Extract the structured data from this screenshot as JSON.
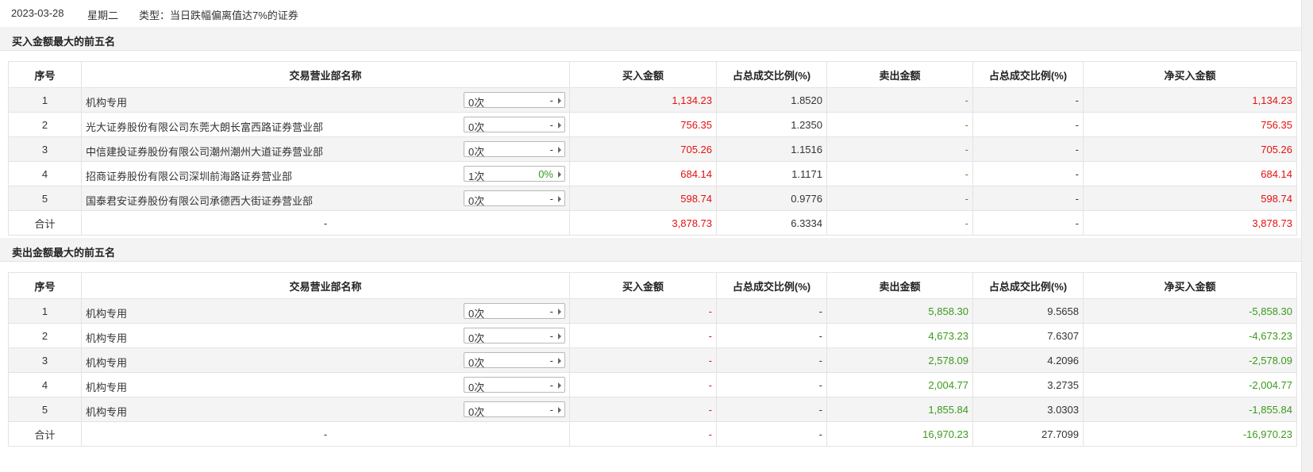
{
  "header": {
    "date": "2023-03-28",
    "weekday": "星期二",
    "type": "类型：当日跌幅偏离值达7%的证券"
  },
  "columns": [
    "序号",
    "交易营业部名称",
    "买入金额",
    "占总成交比例(%)",
    "卖出金额",
    "占总成交比例(%)",
    "净买入金额"
  ],
  "buy_section": {
    "title": "买入金额最大的前五名",
    "rows": [
      {
        "no": "1",
        "name": "机构专用",
        "count": "0次",
        "pct": "-",
        "buy": "1,134.23",
        "buy_ratio": "1.8520",
        "sell": "-",
        "sell_ratio": "-",
        "net": "1,134.23"
      },
      {
        "no": "2",
        "name": "光大证券股份有限公司东莞大朗长富西路证券营业部",
        "count": "0次",
        "pct": "-",
        "buy": "756.35",
        "buy_ratio": "1.2350",
        "sell": "-",
        "sell_ratio": "-",
        "net": "756.35"
      },
      {
        "no": "3",
        "name": "中信建投证券股份有限公司潮州潮州大道证券营业部",
        "count": "0次",
        "pct": "-",
        "buy": "705.26",
        "buy_ratio": "1.1516",
        "sell": "-",
        "sell_ratio": "-",
        "net": "705.26"
      },
      {
        "no": "4",
        "name": "招商证券股份有限公司深圳前海路证券营业部",
        "count": "1次",
        "pct": "0%",
        "buy": "684.14",
        "buy_ratio": "1.1171",
        "sell": "-",
        "sell_ratio": "-",
        "net": "684.14"
      },
      {
        "no": "5",
        "name": "国泰君安证券股份有限公司承德西大街证券营业部",
        "count": "0次",
        "pct": "-",
        "buy": "598.74",
        "buy_ratio": "0.9776",
        "sell": "-",
        "sell_ratio": "-",
        "net": "598.74"
      }
    ],
    "total": {
      "label": "合计",
      "name": "-",
      "buy": "3,878.73",
      "buy_ratio": "6.3334",
      "sell": "-",
      "sell_ratio": "-",
      "net": "3,878.73"
    }
  },
  "sell_section": {
    "title": "卖出金额最大的前五名",
    "rows": [
      {
        "no": "1",
        "name": "机构专用",
        "count": "0次",
        "pct": "-",
        "buy": "-",
        "buy_ratio": "-",
        "sell": "5,858.30",
        "sell_ratio": "9.5658",
        "net": "-5,858.30"
      },
      {
        "no": "2",
        "name": "机构专用",
        "count": "0次",
        "pct": "-",
        "buy": "-",
        "buy_ratio": "-",
        "sell": "4,673.23",
        "sell_ratio": "7.6307",
        "net": "-4,673.23"
      },
      {
        "no": "3",
        "name": "机构专用",
        "count": "0次",
        "pct": "-",
        "buy": "-",
        "buy_ratio": "-",
        "sell": "2,578.09",
        "sell_ratio": "4.2096",
        "net": "-2,578.09"
      },
      {
        "no": "4",
        "name": "机构专用",
        "count": "0次",
        "pct": "-",
        "buy": "-",
        "buy_ratio": "-",
        "sell": "2,004.77",
        "sell_ratio": "3.2735",
        "net": "-2,004.77"
      },
      {
        "no": "5",
        "name": "机构专用",
        "count": "0次",
        "pct": "-",
        "buy": "-",
        "buy_ratio": "-",
        "sell": "1,855.84",
        "sell_ratio": "3.0303",
        "net": "-1,855.84"
      }
    ],
    "total": {
      "label": "合计",
      "name": "-",
      "buy": "-",
      "buy_ratio": "-",
      "sell": "16,970.23",
      "sell_ratio": "27.7099",
      "net": "-16,970.23"
    }
  },
  "colors": {
    "positive": "#e4100f",
    "negative": "#3a9a1c"
  }
}
